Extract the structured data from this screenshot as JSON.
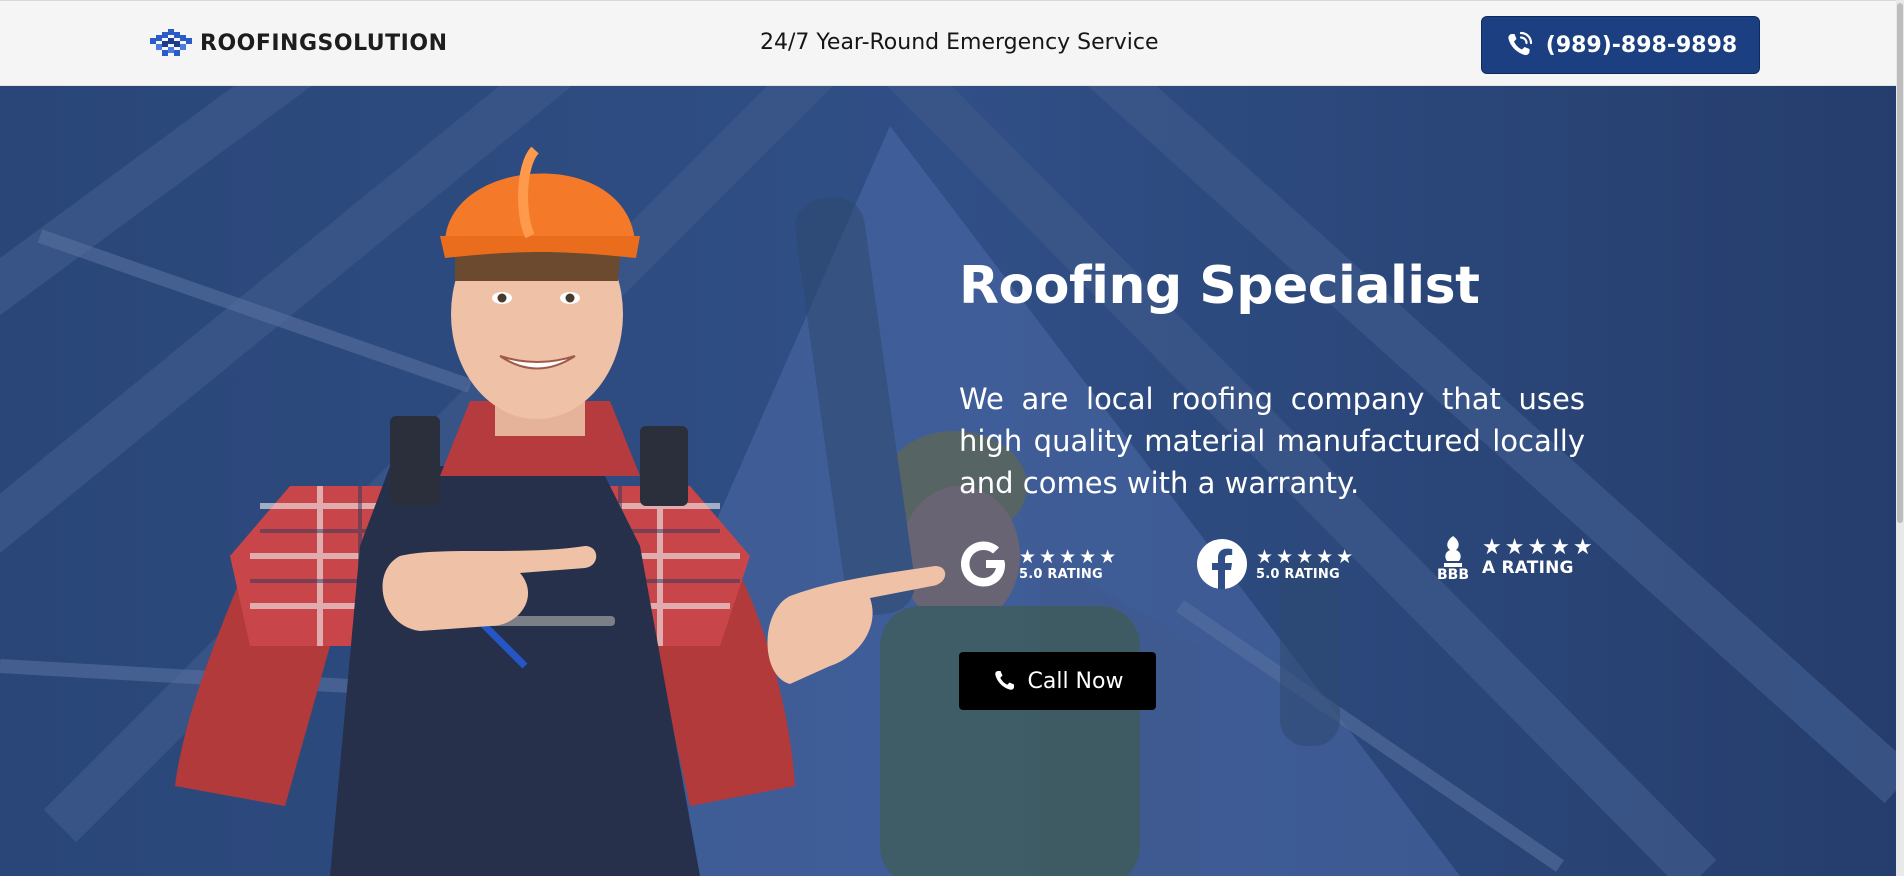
{
  "brand": {
    "name": "ROOFINGSOLUTION"
  },
  "header": {
    "emergency_text": "24/7 Year-Round Emergency Service",
    "phone_label": "(989)-898-9898"
  },
  "hero": {
    "title": "Roofing Specialist",
    "description": "We are local roofing company that uses high quality material manufactured locally and comes with a warranty.",
    "cta_label": "Call Now"
  },
  "badges": [
    {
      "icon": "google-icon",
      "stars": "★★★★★",
      "rating": "5.0 RATING"
    },
    {
      "icon": "facebook-icon",
      "stars": "★★★★★",
      "rating": "5.0 RATING"
    },
    {
      "icon": "bbb-icon",
      "stars": "★★★★★",
      "rating": "A RATING",
      "icon_text": "BBB"
    }
  ],
  "colors": {
    "header_bg": "#f5f5f5",
    "phone_button_bg": "#1b3f80",
    "hero_overlay": "#1e3563",
    "cta_bg": "#000000",
    "hard_hat": "#f47a2a"
  }
}
